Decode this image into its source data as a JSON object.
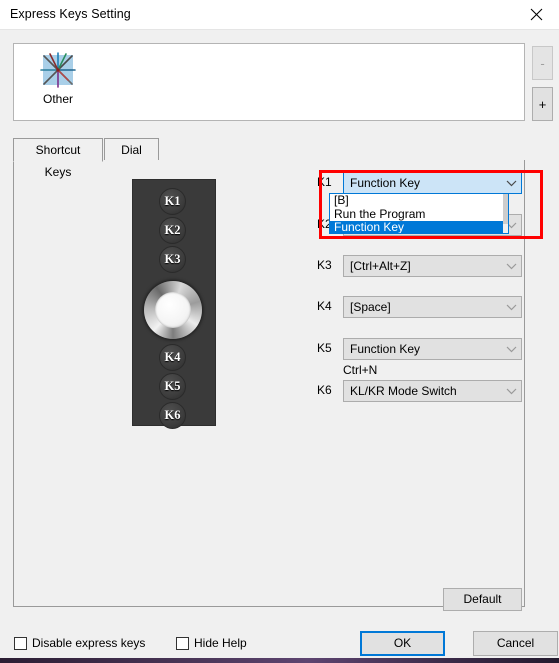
{
  "window": {
    "title": "Express Keys Setting",
    "close_icon": "close-icon"
  },
  "app_strip": {
    "apps": [
      {
        "label": "Other",
        "icon": "starburst-icon"
      }
    ],
    "remove_label": "-",
    "add_label": "+"
  },
  "tabs": [
    {
      "label": "Shortcut Keys",
      "active": true
    },
    {
      "label": "Dial",
      "active": false
    }
  ],
  "device": {
    "buttons": [
      "K1",
      "K2",
      "K3",
      "K4",
      "K5",
      "K6"
    ],
    "dial": "dial-wheel"
  },
  "keys": [
    {
      "label": "K1",
      "value": "Function Key",
      "sub": "",
      "focused": true
    },
    {
      "label": "K2",
      "value": "",
      "sub": "",
      "focused": false
    },
    {
      "label": "K3",
      "value": "[Ctrl+Alt+Z]",
      "sub": "",
      "focused": false
    },
    {
      "label": "K4",
      "value": "[Space]",
      "sub": "",
      "focused": false
    },
    {
      "label": "K5",
      "value": "Function Key",
      "sub": "Ctrl+N",
      "focused": false
    },
    {
      "label": "K6",
      "value": "KL/KR Mode Switch",
      "sub": "",
      "focused": false
    }
  ],
  "dropdown": {
    "open": true,
    "owner": "K1",
    "options": [
      {
        "label": "[B]",
        "selected": false
      },
      {
        "label": "Run the Program",
        "selected": false
      },
      {
        "label": "Function Key",
        "selected": true
      }
    ]
  },
  "highlight": {
    "color": "#ff0000"
  },
  "buttons": {
    "default_label": "Default",
    "ok_label": "OK",
    "cancel_label": "Cancel"
  },
  "checkboxes": [
    {
      "label": "Disable express keys",
      "checked": false
    },
    {
      "label": "Hide Help",
      "checked": false
    }
  ],
  "colors": {
    "accent": "#0078d7",
    "highlight": "#ff0000",
    "window_bg": "#f0f0f0",
    "panel_bg": "#ffffff",
    "device_bg": "#3a3a3a"
  }
}
